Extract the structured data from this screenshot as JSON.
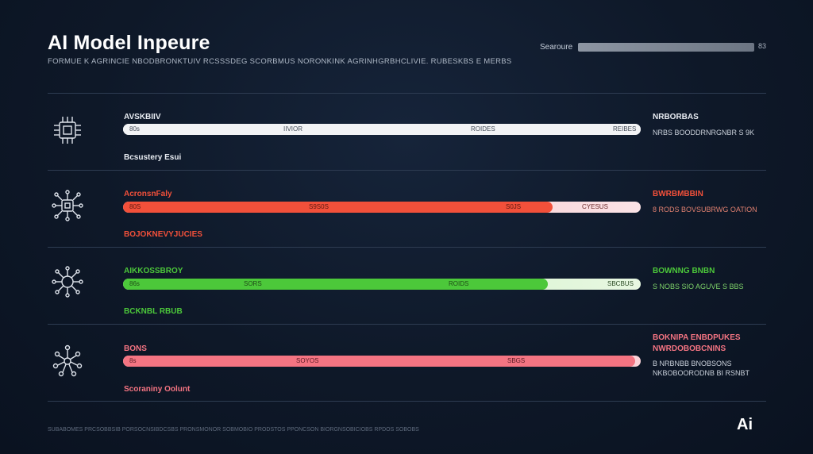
{
  "header": {
    "title": "AI Model Inpeure",
    "subtitle": "FORMUE K AGRINCIE NBODBRONKTUIV RCSSSDEG SCORBMUS NORONKINK AGRINHGRBHCLIVIE. RUBESKBS E MERBS",
    "search_label": "Searoure",
    "search_count": "83"
  },
  "colors": {
    "background": "#0e1828",
    "white_track": "#f2f3f5",
    "red": "#f2503a",
    "green": "#4cc83a",
    "pink": "#f47482",
    "divider": "#2e3c52"
  },
  "rows": [
    {
      "icon": "cpu-chip-icon",
      "bar_title": "AVSKBIIV",
      "ticks": [
        "80s",
        "IIVIOR",
        "ROIDES",
        "REIBES"
      ],
      "progress": 1.0,
      "footer": "Bcsustery Esui",
      "side_title": "NRBORBAS",
      "side_text": "NRBS BOODDRNRGNBR  S 9K",
      "side_text2": ""
    },
    {
      "icon": "neural-chip-icon",
      "bar_title": "AcronsnFaly",
      "ticks": [
        "80S",
        "S9S0S",
        "S0JS",
        "CYESUS"
      ],
      "progress": 0.83,
      "footer": "BOJOKNEVYJUCIES",
      "side_title": "BWRBMBBIN",
      "side_text": "8 RODS  BOVSUBRWG  OATION",
      "side_text2": ""
    },
    {
      "icon": "network-node-icon",
      "bar_title": "AIKKOSSBROY",
      "ticks": [
        "86s",
        "SORS",
        "ROIDS",
        "SBCBUS"
      ],
      "progress": 0.82,
      "footer": "BCKNBL RBUB",
      "side_title": "BOWNNG BNBN",
      "side_text": "S NOBS  SIO AGUVE  S BBS",
      "side_text2": ""
    },
    {
      "icon": "molecule-graph-icon",
      "bar_title": "BONS",
      "ticks": [
        "8s",
        "SOYOS",
        "SBGS",
        ""
      ],
      "progress": 0.99,
      "footer": "Scoraniny Oolunt",
      "side_title": "BOKNIPA ENBDPUKES",
      "side_title2": "NWRDOBOBCNINS",
      "side_text": "B NRBNBB BNOBSONS",
      "side_text2": "NKBOBOORODNB  BI RSNBT"
    }
  ],
  "footer_text": "SUBABOMES PRCSOBBSIB PORSOCNSIBDCSBS PRONSMONOR SOBMOBIO PRODSTOS PPONCSON BIORGNSOBICIOBS RPDOS SOBOBS",
  "logo_text": "Ai"
}
